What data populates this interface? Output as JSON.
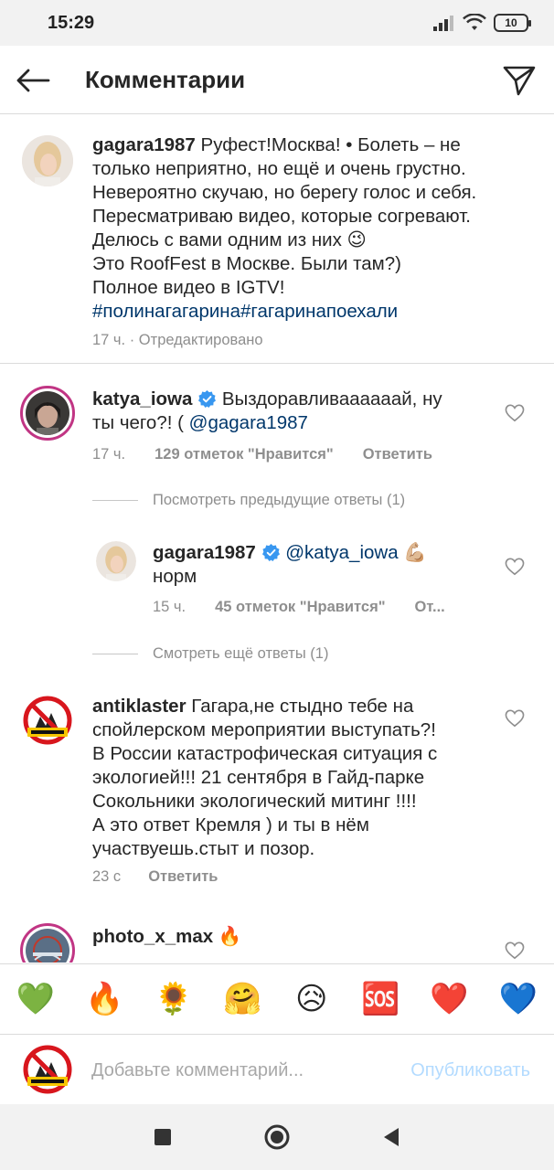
{
  "status_bar": {
    "time": "15:29",
    "battery": "10"
  },
  "header": {
    "title": "Комментарии"
  },
  "caption": {
    "username": "gagara1987",
    "lines": [
      "Руфест!Москва! • Болеть – не",
      "только неприятно, но ещё и очень грустно.",
      "Невероятно скучаю, но берегу голос и себя.",
      "Пересматриваю видео, которые согревают.",
      "Делюсь с вами одним из них 😉",
      "Это RoofFest в Москве. Были там?)",
      "Полное видео в IGTV!"
    ],
    "hashtags": "#полинагагарина#гагаринапоехали",
    "time": "17 ч.",
    "edited": "Отредактировано"
  },
  "comments": [
    {
      "username": "katya_iowa",
      "verified": true,
      "text_line1": "Выздоравливаааааай, ну",
      "text_line2_prefix": "ты чего?! ( ",
      "mention": "@gagara1987",
      "time": "17 ч.",
      "likes": "129 отметок \"Нравится\"",
      "reply": "Ответить",
      "view_replies": "Посмотреть предыдущие ответы (1)"
    },
    {
      "username": "gagara1987",
      "verified": true,
      "mention": "@katya_iowa",
      "emoji": "💪🏼",
      "text_line2": "норм",
      "time": "15 ч.",
      "likes": "45 отметок \"Нравится\"",
      "reply": "От...",
      "more_replies": "Смотреть ещё ответы (1)"
    },
    {
      "username": "antiklaster",
      "lines": [
        "Гагара,не стыдно тебе на",
        "спойлерском мероприятии выступать?!",
        "В России катастрофическая ситуация с",
        "экологией!!! 21 сентября в Гайд-парке",
        "Сокольники экологический митинг !!!!",
        "А это ответ Кремля ) и ты в нём",
        "участвуешь.стыт и позор."
      ],
      "time": "23 с",
      "reply": "Ответить"
    },
    {
      "username": "photo_x_max",
      "emoji": "🔥"
    }
  ],
  "emoji_bar": [
    "💚",
    "🔥",
    "🌻",
    "🤗",
    "😥",
    "🆘",
    "❤️",
    "💙"
  ],
  "input": {
    "placeholder": "Добавьте комментарий...",
    "publish": "Опубликовать"
  },
  "colors": {
    "link": "#00376b",
    "meta": "#8e8e8e",
    "verified": "#3897f0",
    "publish_disabled": "#b3dbff"
  }
}
